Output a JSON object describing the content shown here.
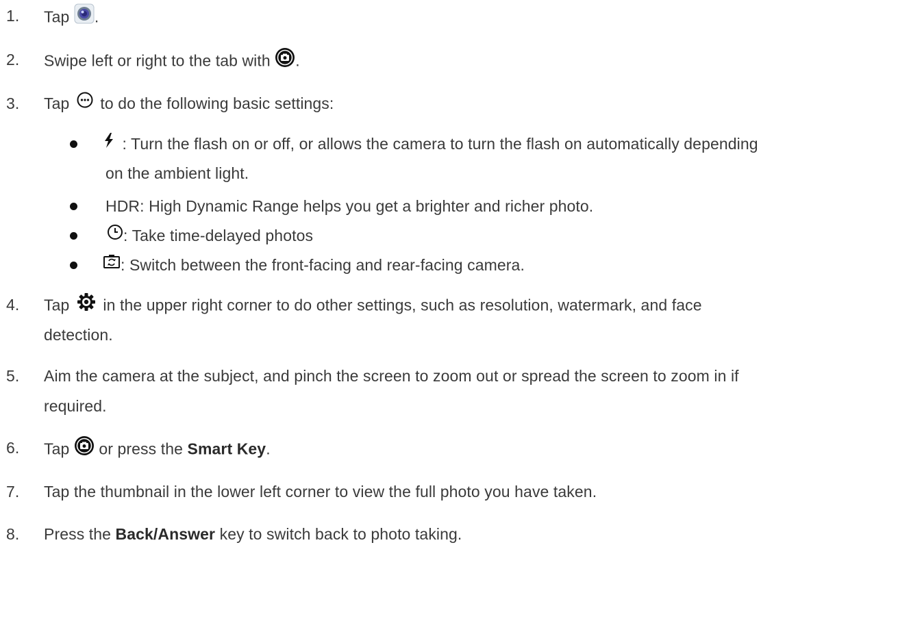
{
  "steps": [
    {
      "num": "1.",
      "parts": [
        "Tap ",
        "."
      ],
      "icon": "camera-app-icon"
    },
    {
      "num": "2.",
      "parts": [
        "Swipe left or right to the tab with ",
        "."
      ],
      "icon": "camera-shutter-icon"
    },
    {
      "num": "3.",
      "parts": [
        "Tap ",
        " to do the following basic settings:"
      ],
      "icon": "more-options-icon"
    },
    {
      "num": "4.",
      "parts": [
        "Tap ",
        " in the upper right corner to do other settings, such as resolution, watermark, and face"
      ],
      "cont": "detection.",
      "icon": "gear-icon"
    },
    {
      "num": "5.",
      "text": "Aim the camera at the subject, and pinch the screen to zoom out or spread the screen to zoom in if",
      "cont": "required."
    },
    {
      "num": "6.",
      "parts": [
        "Tap ",
        " or press the ",
        "."
      ],
      "bold": "Smart Key",
      "icon": "camera-shutter-icon"
    },
    {
      "num": "7.",
      "text": "Tap the thumbnail in the lower left corner to view the full photo you have taken."
    },
    {
      "num": "8.",
      "parts": [
        "Press the ",
        " key to switch back to photo taking."
      ],
      "bold": "Back/Answer"
    }
  ],
  "bullets": [
    {
      "icon": "flash-icon",
      "text": " : Turn the flash on or off, or allows the camera to turn the flash on automatically depending",
      "cont": "on the ambient light."
    },
    {
      "text": "HDR: High Dynamic Range helps you get a brighter and richer photo."
    },
    {
      "icon": "timer-icon",
      "text": ": Take time-delayed photos"
    },
    {
      "icon": "switch-camera-icon",
      "text": ": Switch between the front-facing and rear-facing camera."
    }
  ]
}
